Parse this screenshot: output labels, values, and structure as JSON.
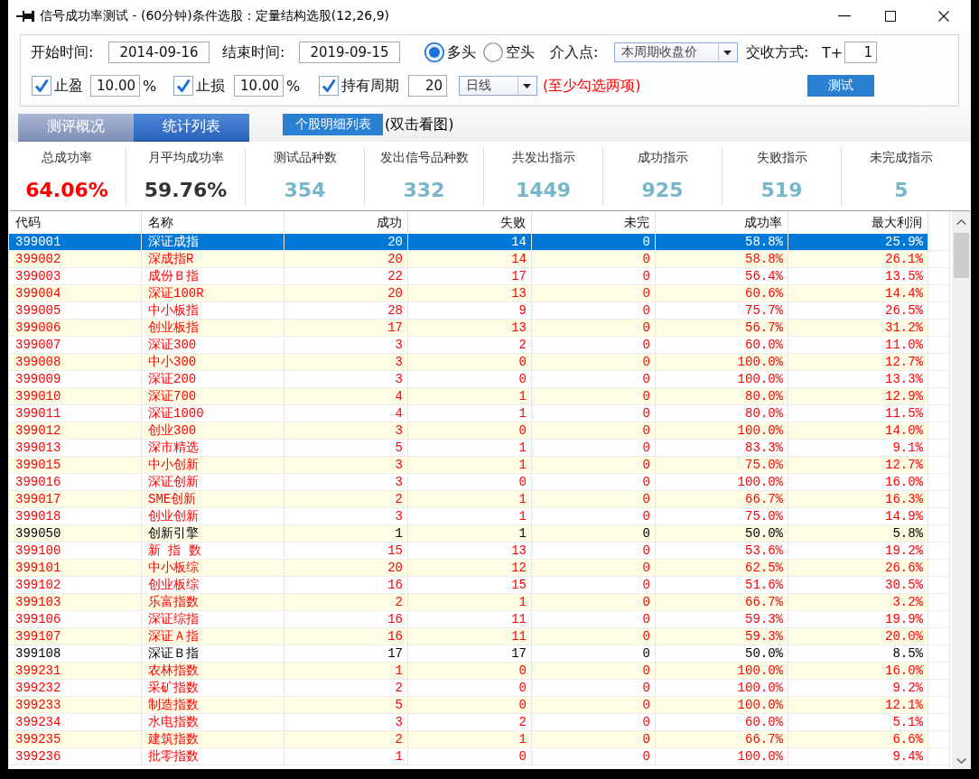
{
  "window": {
    "title": "信号成功率测试 - (60分钟)条件选股：定量结构选股(12,26,9)"
  },
  "params": {
    "start_time": {
      "label": "开始时间:",
      "value": "2014-09-16"
    },
    "end_time": {
      "label": "结束时间:",
      "value": "2019-09-15"
    },
    "direction": [
      {
        "label": "多头",
        "selected": true
      },
      {
        "label": "空头",
        "selected": false
      }
    ],
    "entry_point": {
      "label": "介入点:",
      "value": "本周期收盘价"
    },
    "settlement": {
      "label": "交收方式:",
      "prefix": "T+",
      "value": "1"
    },
    "conditions": [
      {
        "kind": "percent",
        "label": "止盈",
        "checked": true,
        "value": "10.00",
        "unit": "%"
      },
      {
        "kind": "percent",
        "label": "止损",
        "checked": true,
        "value": "10.00",
        "unit": "%"
      },
      {
        "kind": "period",
        "label": "持有周期",
        "checked": true,
        "value": "20",
        "period": "日线"
      }
    ],
    "hint": "(至少勾选两项)",
    "test_button": "测试"
  },
  "tabs": [
    {
      "label": "测评概况",
      "selected": false
    },
    {
      "label": "统计列表",
      "selected": true
    }
  ],
  "detail_button": "个股明细列表",
  "detail_hint": "(双击看图)",
  "stats": [
    {
      "label": "总成功率",
      "value": "64.06%",
      "color": "#ff0000"
    },
    {
      "label": "月平均成功率",
      "value": "59.76%",
      "color": "#333333"
    },
    {
      "label": "测试品种数",
      "value": "354",
      "color": "#78b6c9"
    },
    {
      "label": "发出信号品种数",
      "value": "332",
      "color": "#78b6c9"
    },
    {
      "label": "共发出指示",
      "value": "1449",
      "color": "#78b6c9"
    },
    {
      "label": "成功指示",
      "value": "925",
      "color": "#78b6c9"
    },
    {
      "label": "失败指示",
      "value": "519",
      "color": "#78b6c9"
    },
    {
      "label": "未完成指示",
      "value": "5",
      "color": "#78b6c9"
    }
  ],
  "table": {
    "columns": [
      "代码",
      "名称",
      "成功",
      "失败",
      "未完",
      "成功率",
      "最大利润"
    ],
    "rows": [
      {
        "cells": [
          "399001",
          "深证成指",
          "20",
          "14",
          "0",
          "58.8%",
          "25.9%"
        ],
        "selected": true
      },
      {
        "cells": [
          "399002",
          "深成指R",
          "20",
          "14",
          "0",
          "58.8%",
          "26.1%"
        ],
        "selected": false,
        "color": "#ff0000"
      },
      {
        "cells": [
          "399003",
          "成份Ｂ指",
          "22",
          "17",
          "0",
          "56.4%",
          "13.5%"
        ],
        "selected": false,
        "color": "#ff0000"
      },
      {
        "cells": [
          "399004",
          "深证100R",
          "20",
          "13",
          "0",
          "60.6%",
          "14.4%"
        ],
        "selected": false,
        "color": "#ff0000"
      },
      {
        "cells": [
          "399005",
          "中小板指",
          "28",
          "9",
          "0",
          "75.7%",
          "26.5%"
        ],
        "selected": false,
        "color": "#ff0000"
      },
      {
        "cells": [
          "399006",
          "创业板指",
          "17",
          "13",
          "0",
          "56.7%",
          "31.2%"
        ],
        "selected": false,
        "color": "#ff0000"
      },
      {
        "cells": [
          "399007",
          "深证300",
          "3",
          "2",
          "0",
          "60.0%",
          "11.0%"
        ],
        "selected": false,
        "color": "#ff0000"
      },
      {
        "cells": [
          "399008",
          "中小300",
          "3",
          "0",
          "0",
          "100.0%",
          "12.7%"
        ],
        "selected": false,
        "color": "#ff0000"
      },
      {
        "cells": [
          "399009",
          "深证200",
          "3",
          "0",
          "0",
          "100.0%",
          "13.3%"
        ],
        "selected": false,
        "color": "#ff0000"
      },
      {
        "cells": [
          "399010",
          "深证700",
          "4",
          "1",
          "0",
          "80.0%",
          "12.9%"
        ],
        "selected": false,
        "color": "#ff0000"
      },
      {
        "cells": [
          "399011",
          "深证1000",
          "4",
          "1",
          "0",
          "80.0%",
          "11.5%"
        ],
        "selected": false,
        "color": "#ff0000"
      },
      {
        "cells": [
          "399012",
          "创业300",
          "3",
          "0",
          "0",
          "100.0%",
          "14.0%"
        ],
        "selected": false,
        "color": "#ff0000"
      },
      {
        "cells": [
          "399013",
          "深市精选",
          "5",
          "1",
          "0",
          "83.3%",
          "9.1%"
        ],
        "selected": false,
        "color": "#ff0000"
      },
      {
        "cells": [
          "399015",
          "中小创新",
          "3",
          "1",
          "0",
          "75.0%",
          "12.7%"
        ],
        "selected": false,
        "color": "#ff0000"
      },
      {
        "cells": [
          "399016",
          "深证创新",
          "3",
          "0",
          "0",
          "100.0%",
          "16.0%"
        ],
        "selected": false,
        "color": "#ff0000"
      },
      {
        "cells": [
          "399017",
          "SME创新",
          "2",
          "1",
          "0",
          "66.7%",
          "16.3%"
        ],
        "selected": false,
        "color": "#ff0000"
      },
      {
        "cells": [
          "399018",
          "创业创新",
          "3",
          "1",
          "0",
          "75.0%",
          "14.9%"
        ],
        "selected": false,
        "color": "#ff0000"
      },
      {
        "cells": [
          "399050",
          "创新引擎",
          "1",
          "1",
          "0",
          "50.0%",
          "5.8%"
        ],
        "selected": false,
        "color": "#000000"
      },
      {
        "cells": [
          "399100",
          "新 指 数",
          "15",
          "13",
          "0",
          "53.6%",
          "19.2%"
        ],
        "selected": false,
        "color": "#ff0000"
      },
      {
        "cells": [
          "399101",
          "中小板综",
          "20",
          "12",
          "0",
          "62.5%",
          "26.6%"
        ],
        "selected": false,
        "color": "#ff0000"
      },
      {
        "cells": [
          "399102",
          "创业板综",
          "16",
          "15",
          "0",
          "51.6%",
          "30.5%"
        ],
        "selected": false,
        "color": "#ff0000"
      },
      {
        "cells": [
          "399103",
          "乐富指数",
          "2",
          "1",
          "0",
          "66.7%",
          "3.2%"
        ],
        "selected": false,
        "color": "#ff0000"
      },
      {
        "cells": [
          "399106",
          "深证综指",
          "16",
          "11",
          "0",
          "59.3%",
          "19.9%"
        ],
        "selected": false,
        "color": "#ff0000"
      },
      {
        "cells": [
          "399107",
          "深证Ａ指",
          "16",
          "11",
          "0",
          "59.3%",
          "20.0%"
        ],
        "selected": false,
        "color": "#ff0000"
      },
      {
        "cells": [
          "399108",
          "深证Ｂ指",
          "17",
          "17",
          "0",
          "50.0%",
          "8.5%"
        ],
        "selected": false,
        "color": "#000000"
      },
      {
        "cells": [
          "399231",
          "农林指数",
          "1",
          "0",
          "0",
          "100.0%",
          "16.0%"
        ],
        "selected": false,
        "color": "#ff0000"
      },
      {
        "cells": [
          "399232",
          "采矿指数",
          "2",
          "0",
          "0",
          "100.0%",
          "9.2%"
        ],
        "selected": false,
        "color": "#ff0000"
      },
      {
        "cells": [
          "399233",
          "制造指数",
          "5",
          "0",
          "0",
          "100.0%",
          "12.1%"
        ],
        "selected": false,
        "color": "#ff0000"
      },
      {
        "cells": [
          "399234",
          "水电指数",
          "3",
          "2",
          "0",
          "60.0%",
          "5.1%"
        ],
        "selected": false,
        "color": "#ff0000"
      },
      {
        "cells": [
          "399235",
          "建筑指数",
          "2",
          "1",
          "0",
          "66.7%",
          "6.6%"
        ],
        "selected": false,
        "color": "#ff0000"
      },
      {
        "cells": [
          "399236",
          "批零指数",
          "1",
          "0",
          "0",
          "100.0%",
          "9.4%"
        ],
        "selected": false,
        "color": "#ff0000"
      }
    ]
  }
}
